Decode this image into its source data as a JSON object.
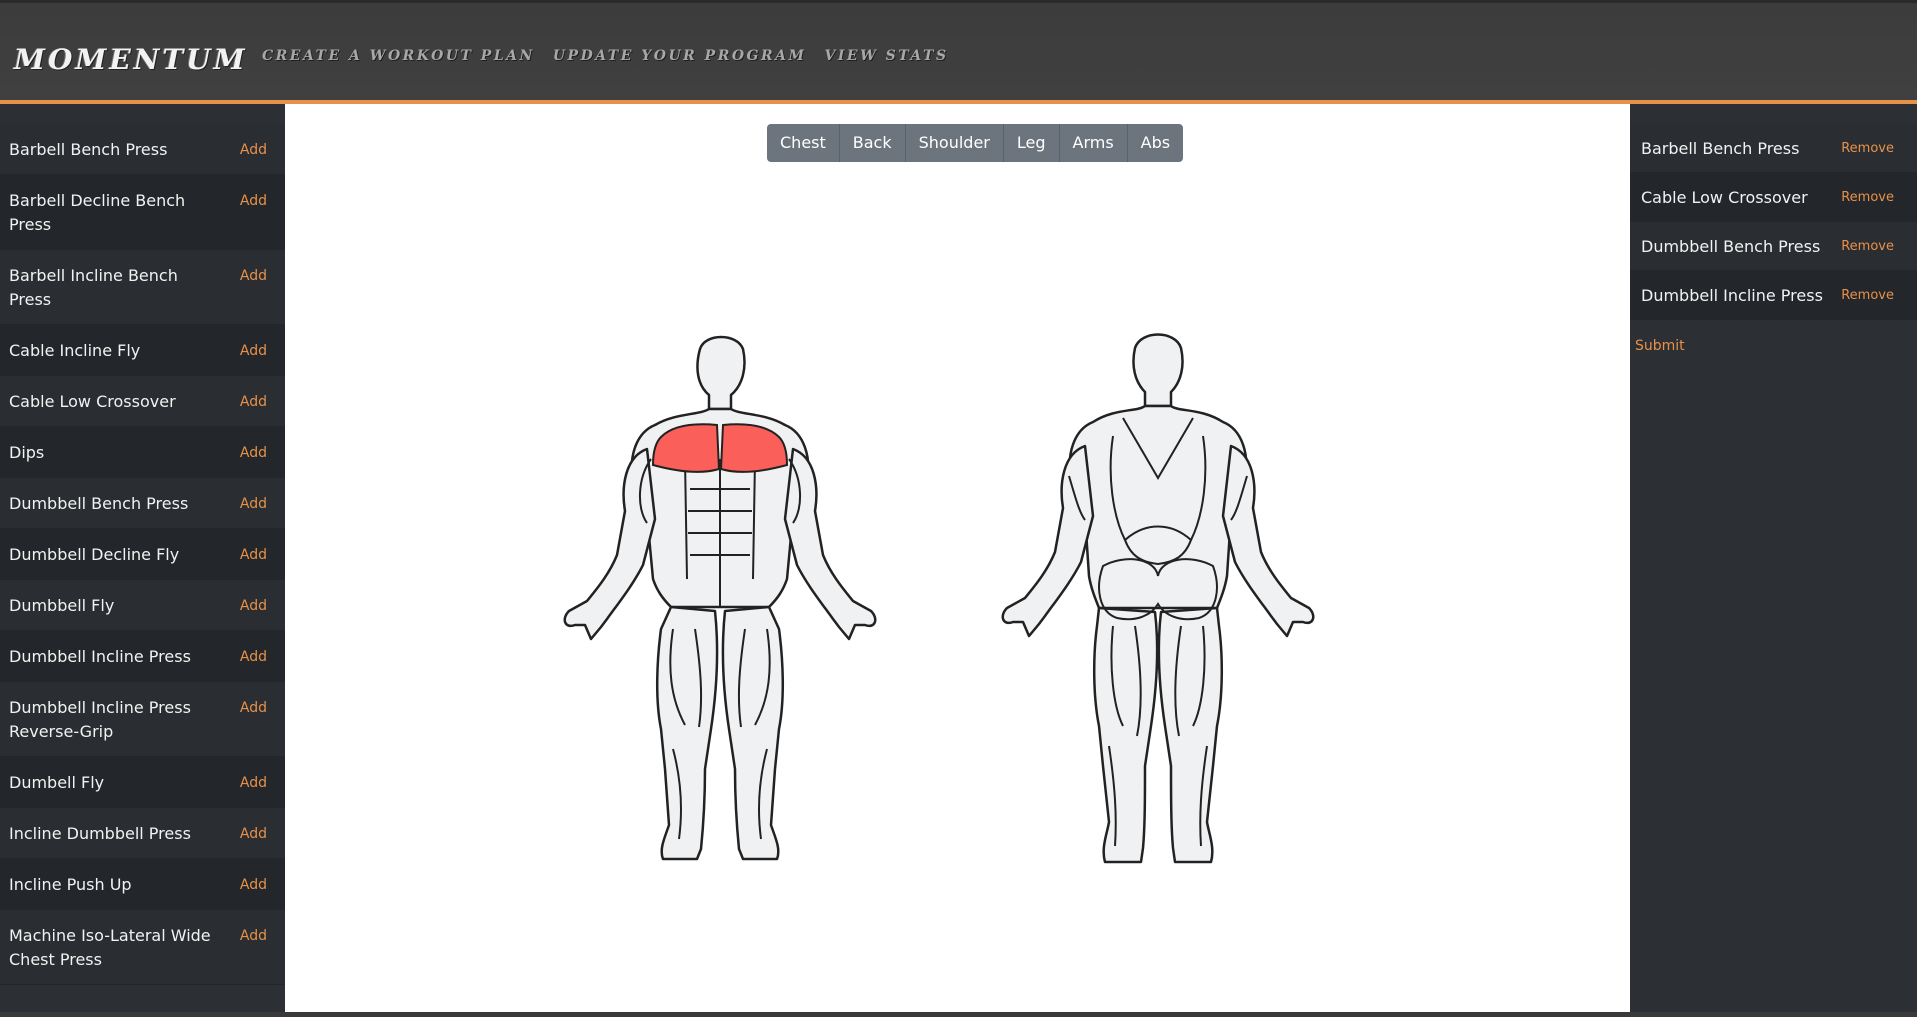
{
  "header": {
    "brand": "MOMENTUM",
    "nav": [
      {
        "label": "Create a Workout Plan"
      },
      {
        "label": "Update your Program"
      },
      {
        "label": "View Stats"
      }
    ]
  },
  "exercise_list": {
    "add_label": "Add",
    "items": [
      {
        "name": "Barbell Bench Press"
      },
      {
        "name": "Barbell Decline Bench Press"
      },
      {
        "name": "Barbell Incline Bench Press"
      },
      {
        "name": "Cable Incline Fly"
      },
      {
        "name": "Cable Low Crossover"
      },
      {
        "name": "Dips"
      },
      {
        "name": "Dumbbell Bench Press"
      },
      {
        "name": "Dumbbell Decline Fly"
      },
      {
        "name": "Dumbbell Fly"
      },
      {
        "name": "Dumbbell Incline Press"
      },
      {
        "name": "Dumbbell Incline Press Reverse-Grip"
      },
      {
        "name": "Dumbell Fly"
      },
      {
        "name": "Incline Dumbbell Press"
      },
      {
        "name": "Incline Push Up"
      },
      {
        "name": "Machine Iso-Lateral Wide Chest Press"
      }
    ]
  },
  "muscle_groups": {
    "tabs": [
      "Chest",
      "Back",
      "Shoulder",
      "Leg",
      "Arms",
      "Abs"
    ],
    "highlighted": "Chest",
    "highlight_color": "#fa5f5a"
  },
  "selected": {
    "remove_label": "Remove",
    "items": [
      {
        "name": "Barbell Bench Press"
      },
      {
        "name": "Cable Low Crossover"
      },
      {
        "name": "Dumbbell Bench Press"
      },
      {
        "name": "Dumbbell Incline Press"
      }
    ],
    "submit_label": "Submit"
  },
  "colors": {
    "accent": "#e8914a",
    "sidebar": "#2c2f33",
    "header": "#3e3e3e",
    "tab": "#6c757d"
  }
}
